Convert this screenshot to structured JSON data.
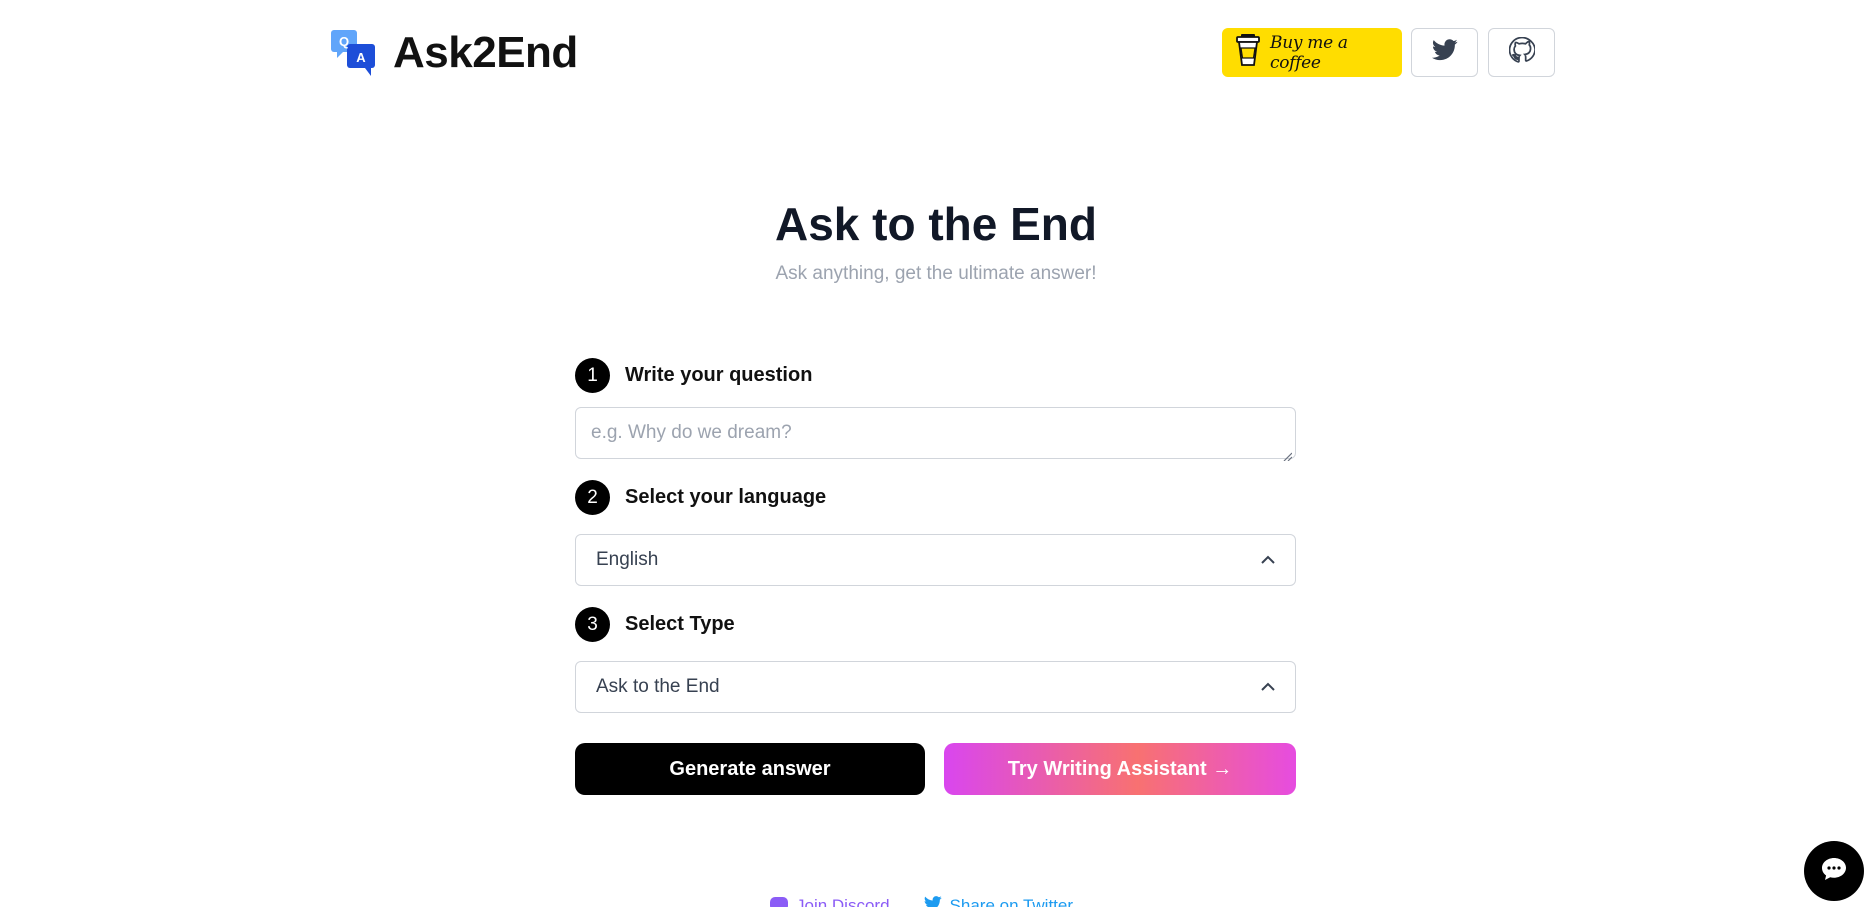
{
  "header": {
    "brand": "Ask2End",
    "logo_letters": {
      "q": "Q",
      "a": "A"
    },
    "coffee_label": "Buy me a coffee",
    "coffee_color": "#FFDD00",
    "twitter_icon": "twitter-icon",
    "github_icon": "github-icon"
  },
  "hero": {
    "title": "Ask to the End",
    "subtitle": "Ask anything, get the ultimate answer!"
  },
  "form": {
    "step1": {
      "number": "1",
      "label": "Write your question",
      "placeholder": "e.g. Why do we dream?"
    },
    "step2": {
      "number": "2",
      "label": "Select your language",
      "selected": "English"
    },
    "step3": {
      "number": "3",
      "label": "Select Type",
      "selected": "Ask to the End"
    }
  },
  "actions": {
    "generate": "Generate answer",
    "assistant": "Try Writing Assistant →"
  },
  "footer": {
    "discord": "Join Discord",
    "twitter": "Share on Twitter",
    "discord_color": "#8b5cf6",
    "twitter_color": "#1d9bf0"
  },
  "chat": {
    "icon": "chat-bubble-icon"
  }
}
